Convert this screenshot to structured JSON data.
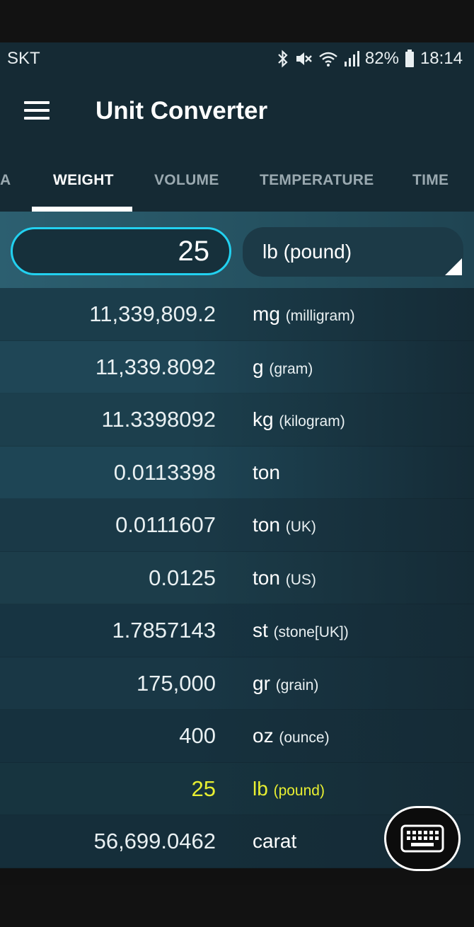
{
  "status_bar": {
    "carrier": "SKT",
    "battery": "82%",
    "time": "18:14",
    "icons": [
      "bluetooth-icon",
      "mute-icon",
      "wifi-icon",
      "signal-icon",
      "battery-icon"
    ]
  },
  "app_bar": {
    "title": "Unit Converter",
    "menu_icon": "menu-icon"
  },
  "tabs": [
    {
      "label": "A",
      "active": false
    },
    {
      "label": "WEIGHT",
      "active": true
    },
    {
      "label": "VOLUME",
      "active": false
    },
    {
      "label": "TEMPERATURE",
      "active": false
    },
    {
      "label": "TIME",
      "active": false
    }
  ],
  "input": {
    "value": "25",
    "unit": "lb (pound)"
  },
  "results": [
    {
      "value": "11,339,809.2",
      "unit": "mg",
      "desc": "(milligram)"
    },
    {
      "value": "11,339.8092",
      "unit": "g",
      "desc": "(gram)"
    },
    {
      "value": "11.3398092",
      "unit": "kg",
      "desc": "(kilogram)"
    },
    {
      "value": "0.0113398",
      "unit": "ton",
      "desc": ""
    },
    {
      "value": "0.0111607",
      "unit": "ton",
      "desc": "(UK)"
    },
    {
      "value": "0.0125",
      "unit": "ton",
      "desc": "(US)"
    },
    {
      "value": "1.7857143",
      "unit": "st",
      "desc": "(stone[UK])"
    },
    {
      "value": "175,000",
      "unit": "gr",
      "desc": "(grain)"
    },
    {
      "value": "400",
      "unit": "oz",
      "desc": "(ounce)"
    },
    {
      "value": "25",
      "unit": "lb",
      "desc": "(pound)",
      "highlight": true
    },
    {
      "value": "56,699.0462",
      "unit": "carat",
      "desc": ""
    }
  ],
  "fab": {
    "icon": "keyboard-icon"
  },
  "colors": {
    "accent": "#22d1f0",
    "highlight": "#e8ef31",
    "header_bg": "#152a34"
  }
}
